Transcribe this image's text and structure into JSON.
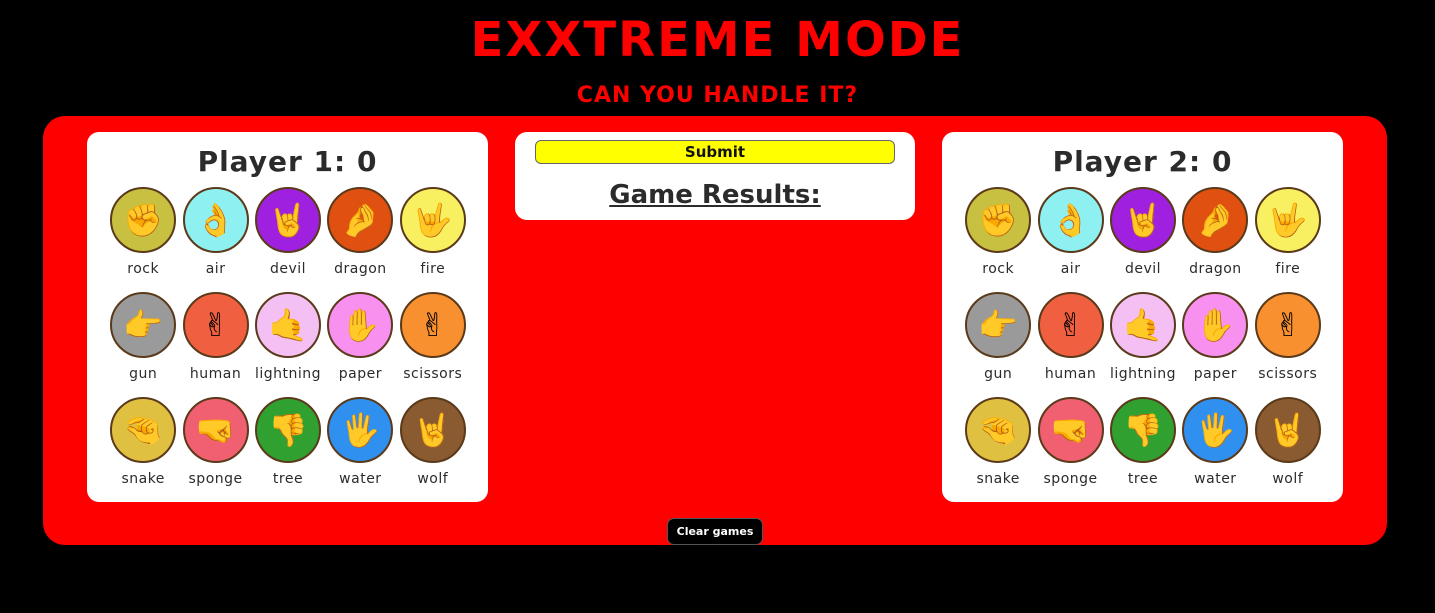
{
  "header": {
    "title": "EXXTREME MODE",
    "subtitle": "CAN YOU HANDLE IT?"
  },
  "player1": {
    "title": "Player 1: 0"
  },
  "player2": {
    "title": "Player 2: 0"
  },
  "center": {
    "submit_label": "Submit",
    "results_heading": "Game Results:"
  },
  "clear_label": "Clear games",
  "hands": [
    {
      "label": "rock",
      "icon": "rock-hand-icon",
      "glyph": "✊",
      "color": "#c8c040"
    },
    {
      "label": "air",
      "icon": "air-hand-icon",
      "glyph": "👌",
      "color": "#8ef0f0"
    },
    {
      "label": "devil",
      "icon": "devil-hand-icon",
      "glyph": "🤘",
      "color": "#a020e0"
    },
    {
      "label": "dragon",
      "icon": "dragon-hand-icon",
      "glyph": "🤌",
      "color": "#e05010"
    },
    {
      "label": "fire",
      "icon": "fire-hand-icon",
      "glyph": "🤟",
      "color": "#f8f060"
    },
    {
      "label": "gun",
      "icon": "gun-hand-icon",
      "glyph": "👉",
      "color": "#9a9a9a"
    },
    {
      "label": "human",
      "icon": "human-hand-icon",
      "glyph": "✌",
      "color": "#f06040"
    },
    {
      "label": "lightning",
      "icon": "lightning-hand-icon",
      "glyph": "🤙",
      "color": "#f4c0f4"
    },
    {
      "label": "paper",
      "icon": "paper-hand-icon",
      "glyph": "✋",
      "color": "#f890f0"
    },
    {
      "label": "scissors",
      "icon": "scissors-hand-icon",
      "glyph": "✌",
      "color": "#f89030"
    },
    {
      "label": "snake",
      "icon": "snake-hand-icon",
      "glyph": "🤏",
      "color": "#e0c040"
    },
    {
      "label": "sponge",
      "icon": "sponge-hand-icon",
      "glyph": "🤜",
      "color": "#f06070"
    },
    {
      "label": "tree",
      "icon": "tree-hand-icon",
      "glyph": "👎",
      "color": "#30a030"
    },
    {
      "label": "water",
      "icon": "water-hand-icon",
      "glyph": "🖐",
      "color": "#3090f0"
    },
    {
      "label": "wolf",
      "icon": "wolf-hand-icon",
      "glyph": "🤘",
      "color": "#8a5a30"
    }
  ]
}
